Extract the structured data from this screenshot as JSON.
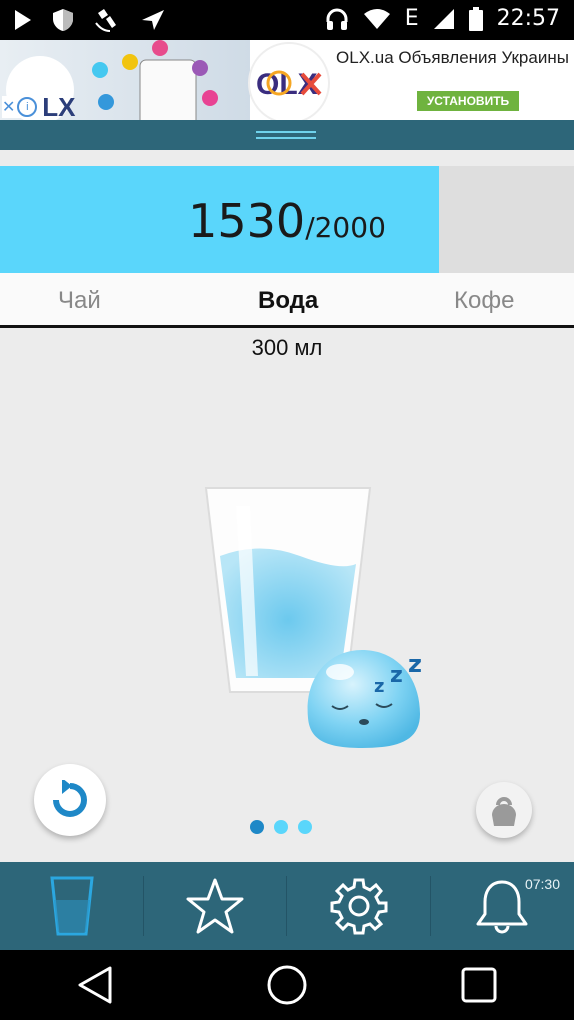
{
  "status_bar": {
    "time": "22:57",
    "network": "E"
  },
  "ad": {
    "title": "OLX.ua Объявления Украины",
    "install_label": "УСТАНОВИТЬ",
    "logo_text": "OLX"
  },
  "progress": {
    "current": "1530",
    "goal": "/2000",
    "fraction": 0.765
  },
  "tabs": [
    {
      "label": "Чай",
      "active": false
    },
    {
      "label": "Вода",
      "active": true
    },
    {
      "label": "Кофе",
      "active": false
    }
  ],
  "volume": "300 мл",
  "page_indicator": {
    "count": 3,
    "active_index": 0
  },
  "bottom_nav": {
    "alarm_time": "07:30",
    "items": [
      "glass-icon",
      "star-icon",
      "gear-icon",
      "bell-icon"
    ]
  },
  "colors": {
    "accent": "#5ad6fb",
    "teal": "#2d6679",
    "active_dot": "#1e88c7"
  }
}
